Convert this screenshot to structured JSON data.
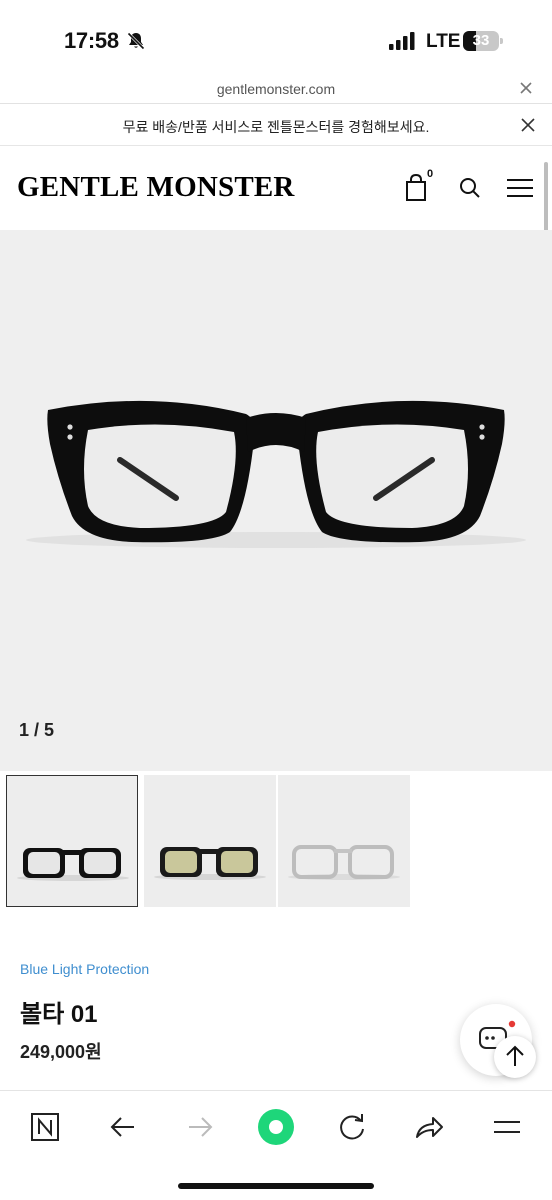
{
  "status_bar": {
    "time": "17:58",
    "network": "LTE",
    "battery": "33",
    "icons": [
      "bell-muted-icon",
      "signal-icon",
      "battery-icon"
    ]
  },
  "browser": {
    "url": "gentlemonster.com"
  },
  "promo_banner": {
    "text": "무료 배송/반품 서비스로 젠틀몬스터를 경험해보세요."
  },
  "header": {
    "logo": "GENTLE MONSTER",
    "cart_count": "0",
    "icons": [
      "shopping-bag-icon",
      "search-icon",
      "menu-icon"
    ]
  },
  "gallery": {
    "counter": "1 / 5",
    "thumbnails": [
      {
        "label": "black-frame",
        "selected": true
      },
      {
        "label": "yellow-tint-frame",
        "selected": false
      },
      {
        "label": "clear-frame",
        "selected": false
      }
    ]
  },
  "product": {
    "tag": "Blue Light Protection",
    "name": "볼타 01",
    "price": "249,000원"
  },
  "toolbar": {
    "icons": [
      "naver-icon",
      "back-icon",
      "forward-icon",
      "home-circle-icon",
      "reload-icon",
      "share-icon",
      "menu-icon"
    ]
  },
  "colors": {
    "tag_blue": "#3f8ecf",
    "gallery_bg": "#efefef",
    "naver_green": "#1ed67a",
    "badge_red": "#e53935"
  }
}
